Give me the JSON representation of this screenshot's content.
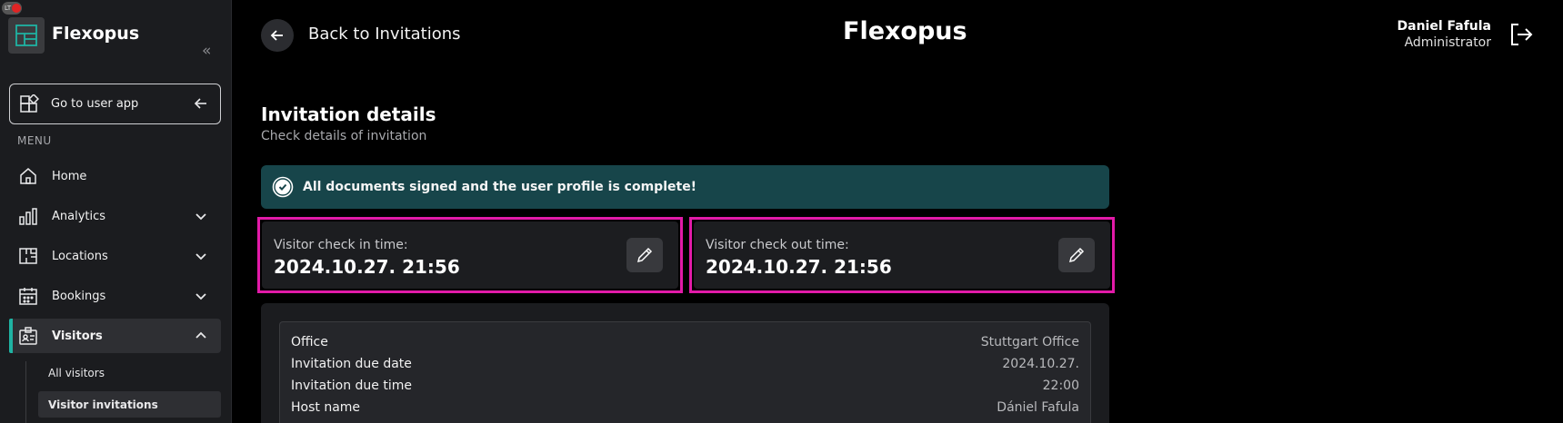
{
  "app": {
    "brand": "Flexopus",
    "badge": "LT"
  },
  "sidebar": {
    "go_user_app": "Go to user app",
    "menu_label": "MENU",
    "items": [
      {
        "label": "Home"
      },
      {
        "label": "Analytics"
      },
      {
        "label": "Locations"
      },
      {
        "label": "Bookings"
      },
      {
        "label": "Visitors"
      }
    ],
    "sub_items": [
      {
        "label": "All visitors"
      },
      {
        "label": "Visitor invitations"
      }
    ],
    "accent_color": "#1fb3a3"
  },
  "header": {
    "back_label": "Back to Invitations",
    "title": "Flexopus",
    "user_name": "Daniel Fafula",
    "user_role": "Administrator"
  },
  "main": {
    "section_title": "Invitation details",
    "section_subtitle": "Check details of invitation",
    "banner_message": "All documents signed and the user profile is complete!",
    "check_in": {
      "label": "Visitor check in time:",
      "value": "2024.10.27. 21:56"
    },
    "check_out": {
      "label": "Visitor check out time:",
      "value": "2024.10.27. 21:56"
    },
    "details": [
      {
        "key": "Office",
        "value": "Stuttgart Office"
      },
      {
        "key": "Invitation due date",
        "value": "2024.10.27."
      },
      {
        "key": "Invitation due time",
        "value": "22:00"
      },
      {
        "key": "Host name",
        "value": "Dániel Fafula"
      }
    ],
    "highlight_color": "#e21aa8",
    "banner_color": "#17454a"
  }
}
